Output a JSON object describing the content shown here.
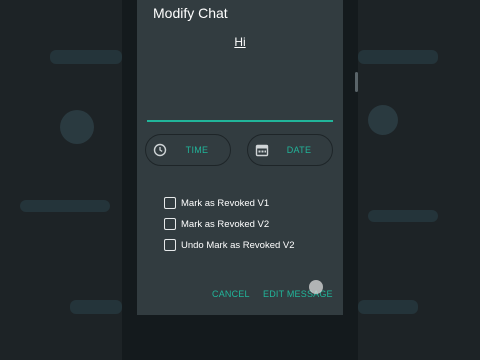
{
  "dialog": {
    "title": "Modify Chat",
    "message": "Hi",
    "time_label": "TIME",
    "date_label": "DATE",
    "checkboxes": [
      {
        "label": "Mark as Revoked V1",
        "checked": false
      },
      {
        "label": "Mark as Revoked V2",
        "checked": false
      },
      {
        "label": "Undo Mark as Revoked V2",
        "checked": false
      }
    ],
    "cancel_label": "CANCEL",
    "edit_label": "EDIT MESSAGE"
  },
  "colors": {
    "accent": "#21b59a",
    "dialog_bg": "#323c40",
    "text": "#ffffff"
  },
  "icons": {
    "time": "clock-icon",
    "date": "calendar-icon"
  }
}
